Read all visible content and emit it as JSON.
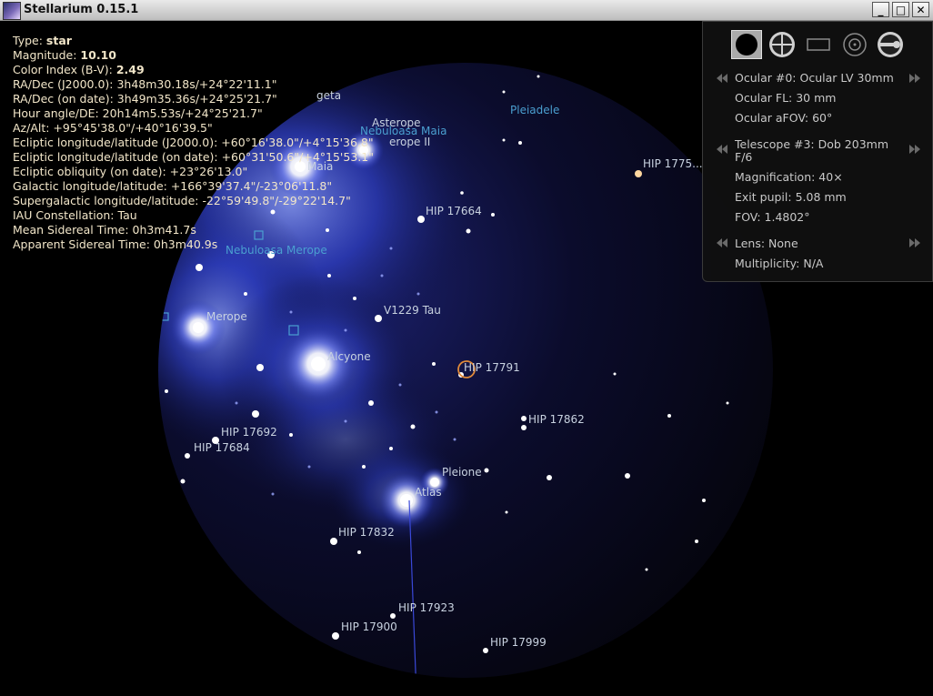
{
  "window": {
    "title": "Stellarium 0.15.1",
    "controls": [
      "_",
      "□",
      "✕"
    ]
  },
  "info": {
    "type_label": "Type:",
    "type_value": "star",
    "magnitude_label": "Magnitude:",
    "magnitude_value": "10.10",
    "color_index_label": "Color Index (B-V):",
    "color_index_value": "2.49",
    "lines": [
      "RA/Dec (J2000.0): 3h48m30.18s/+24°22'11.1\"",
      "RA/Dec (on date): 3h49m35.36s/+24°25'21.7\"",
      "Hour angle/DE: 20h14m5.53s/+24°25'21.7\"",
      "Az/Alt: +95°45'38.0\"/+40°16'39.5\"",
      "Ecliptic longitude/latitude (J2000.0): +60°16'38.0\"/+4°15'36.8\"",
      "Ecliptic longitude/latitude (on date): +60°31'50.6\"/+4°15'53.1\"",
      "Ecliptic obliquity (on date): +23°26'13.0\"",
      "Galactic longitude/latitude: +166°39'37.4\"/-23°06'11.8\"",
      "Supergalactic longitude/latitude: -22°59'49.8\"/-29°22'14.7\"",
      "IAU Constellation: Tau",
      "Mean Sidereal Time: 0h3m41.7s",
      "Apparent Sidereal Time: 0h3m40.9s"
    ]
  },
  "ocular_panel": {
    "tools": [
      "ocular-circle-icon",
      "crosshair-icon",
      "ccd-frame-icon",
      "telrad-icon",
      "configure-icon"
    ],
    "ocular": "Ocular #0: Ocular LV 30mm",
    "ocular_fl": "Ocular FL: 30 mm",
    "ocular_afov": "Ocular aFOV: 60°",
    "telescope_line1": "Telescope #3: Dob 203mm",
    "telescope_line2": "F/6",
    "magnification": "Magnification: 40×",
    "exit_pupil": "Exit pupil: 5.08 mm",
    "fov": "FOV: 1.4802°",
    "lens": "Lens: None",
    "multiplicity": "Multiplicity: N/A"
  },
  "sky_labels": {
    "pleiadele": "Pleiadele",
    "taygeta": "geta",
    "asterope": "Asterope",
    "nebuloasa_maia": "Nebuloasa Maia",
    "asterope_ii": "erope II",
    "maia": "Maia",
    "hip1775": "HIP 1775...",
    "hip17664": "HIP 17664",
    "nebuloasa_merope": "Nebuloasa Merope",
    "merope": "Merope",
    "v1229": "V1229 Tau",
    "alcyone": "Alcyone",
    "hip17791": "HIP 17791",
    "hip17862": "HIP 17862",
    "hip17692": "HIP 17692",
    "hip17684": "HIP 17684",
    "pleione": "Pleione",
    "atlas": "Atlas",
    "hip17832": "HIP 17832",
    "hip17923": "HIP 17923",
    "hip17900": "HIP 17900",
    "hip17999": "HIP 17999"
  },
  "colors": {
    "info_text": "#f2e6c9",
    "star_label": "#c8d2e0",
    "nebula_label": "#4a9fd0",
    "selection_marker": "#e08a3a",
    "panel_text": "#c8c8c8"
  }
}
